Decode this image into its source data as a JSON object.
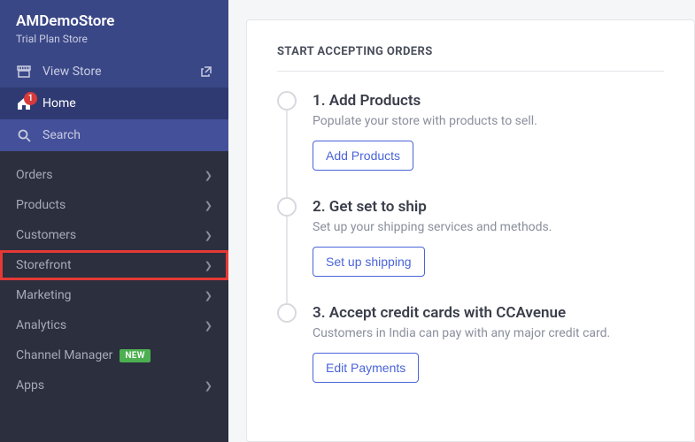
{
  "store": {
    "name": "AMDemoStore",
    "plan": "Trial Plan Store"
  },
  "top": {
    "view_store": "View Store",
    "home": "Home",
    "home_badge": "1",
    "search": "Search"
  },
  "nav": {
    "items": [
      {
        "label": "Orders"
      },
      {
        "label": "Products"
      },
      {
        "label": "Customers"
      },
      {
        "label": "Storefront",
        "highlight": true
      },
      {
        "label": "Marketing"
      },
      {
        "label": "Analytics"
      },
      {
        "label": "Channel Manager",
        "pill": "NEW"
      },
      {
        "label": "Apps"
      }
    ]
  },
  "card": {
    "title": "START ACCEPTING ORDERS",
    "steps": [
      {
        "title": "1. Add Products",
        "desc": "Populate your store with products to sell.",
        "button": "Add Products"
      },
      {
        "title": "2. Get set to ship",
        "desc": "Set up your shipping services and methods.",
        "button": "Set up shipping"
      },
      {
        "title": "3. Accept credit cards with CCAvenue",
        "desc": "Customers in India can pay with any major credit card.",
        "button": "Edit Payments"
      }
    ]
  }
}
